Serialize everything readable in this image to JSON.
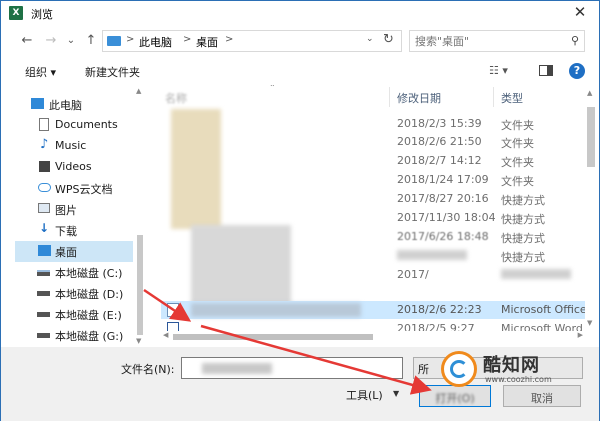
{
  "window": {
    "app_icon": "X",
    "title": "浏览",
    "close": "✕"
  },
  "nav": {
    "back_icon": "←",
    "forward_icon": "→",
    "recent_icon": "⌄",
    "up_icon": "↑",
    "breadcrumbs": [
      "此电脑",
      "桌面"
    ],
    "breadcrumb_separator": ">",
    "dropdown_icon": "⌄",
    "refresh_icon": "↻"
  },
  "search": {
    "placeholder": "搜索\"桌面\"",
    "icon": "⚲"
  },
  "toolbar": {
    "organize": "组织 ▾",
    "new_folder": "新建文件夹",
    "view_icon": "☷ ▾",
    "help": "?"
  },
  "sidebar": {
    "items": [
      {
        "label": "此电脑",
        "icon": "pc-icon"
      },
      {
        "label": "Documents",
        "icon": "document-icon"
      },
      {
        "label": "Music",
        "icon": "music-icon"
      },
      {
        "label": "Videos",
        "icon": "video-icon"
      },
      {
        "label": "WPS云文档",
        "icon": "cloud-icon"
      },
      {
        "label": "图片",
        "icon": "picture-icon"
      },
      {
        "label": "下载",
        "icon": "download-icon"
      },
      {
        "label": "桌面",
        "icon": "desktop-icon",
        "selected": true
      },
      {
        "label": "本地磁盘 (C:)",
        "icon": "drive-icon"
      },
      {
        "label": "本地磁盘 (D:)",
        "icon": "drive-icon"
      },
      {
        "label": "本地磁盘 (E:)",
        "icon": "drive-icon"
      },
      {
        "label": "本地磁盘 (G:)",
        "icon": "drive-icon"
      }
    ]
  },
  "file_list": {
    "columns": {
      "name": "名称",
      "modified": "修改日期",
      "type": "类型"
    },
    "rows": [
      {
        "modified": "2018/2/3 15:39",
        "type": "文件夹"
      },
      {
        "modified": "2018/2/6 21:50",
        "type": "文件夹"
      },
      {
        "modified": "2018/2/7 14:12",
        "type": "文件夹"
      },
      {
        "modified": "2018/1/24 17:09",
        "type": "文件夹"
      },
      {
        "modified": "2017/8/27 20:16",
        "type": "快捷方式"
      },
      {
        "modified": "2017/11/30 18:04",
        "type": "快捷方式"
      },
      {
        "modified": "2017/6/26 18:48",
        "type": "快捷方式"
      },
      {
        "modified": "",
        "type": "快捷方式"
      },
      {
        "modified": "2017/",
        "type": ""
      },
      {
        "modified": "2018/2/6 22:23",
        "type": "Microsoft Office",
        "selected": true
      },
      {
        "modified": "2018/2/5 9:27",
        "type": "Microsoft Word"
      }
    ]
  },
  "bottom": {
    "filename_label": "文件名(N):",
    "filetype_text": "所",
    "tools": "工具(L)",
    "tools_caret": "▼",
    "open": "打开(O)",
    "cancel": "取消"
  },
  "watermark": {
    "name": "酷知网",
    "url": "www.coozhi.com"
  },
  "colors": {
    "accent": "#1f6fc4",
    "selection": "#cce8ff",
    "arrow": "#e53935"
  }
}
